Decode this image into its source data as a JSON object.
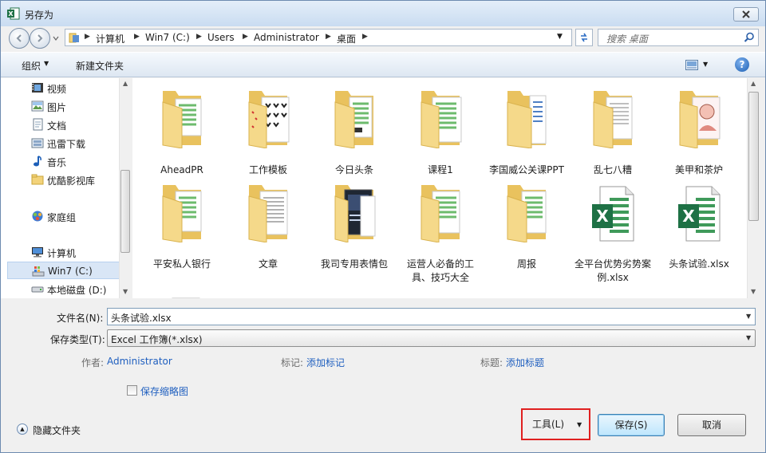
{
  "window": {
    "title": "另存为"
  },
  "address": {
    "crumbs": [
      "计算机",
      "Win7 (C:)",
      "Users",
      "Administrator",
      "桌面"
    ]
  },
  "search": {
    "placeholder": "搜索 桌面"
  },
  "toolbar": {
    "organize": "组织",
    "new_folder": "新建文件夹",
    "help": "?"
  },
  "nav": {
    "items": [
      {
        "label": "视频",
        "icon": "video-library-icon"
      },
      {
        "label": "图片",
        "icon": "pictures-library-icon"
      },
      {
        "label": "文档",
        "icon": "documents-library-icon"
      },
      {
        "label": "迅雷下载",
        "icon": "download-library-icon"
      },
      {
        "label": "音乐",
        "icon": "music-library-icon"
      },
      {
        "label": "优酷影视库",
        "icon": "folder-icon"
      },
      {
        "label": "家庭组",
        "icon": "homegroup-icon"
      },
      {
        "label": "计算机",
        "icon": "computer-icon"
      },
      {
        "label": "Win7 (C:)",
        "icon": "system-drive-icon"
      },
      {
        "label": "本地磁盘 (D:)",
        "icon": "drive-icon"
      }
    ]
  },
  "files": [
    {
      "name": "AheadPR",
      "type": "folder",
      "icon": "folder-docs-icon"
    },
    {
      "name": "工作模板",
      "type": "folder",
      "icon": "folder-cards-icon"
    },
    {
      "name": "今日头条",
      "type": "folder",
      "icon": "folder-docs-icon"
    },
    {
      "name": "课程1",
      "type": "folder",
      "icon": "folder-docs-icon"
    },
    {
      "name": "李国威公关课PPT",
      "type": "folder",
      "icon": "folder-docs-icon"
    },
    {
      "name": "乱七八糟",
      "type": "folder",
      "icon": "folder-docs-icon"
    },
    {
      "name": "美甲和茶炉",
      "type": "folder",
      "icon": "folder-image-icon"
    },
    {
      "name": "平安私人银行",
      "type": "folder",
      "icon": "folder-docs-icon"
    },
    {
      "name": "文章",
      "type": "folder",
      "icon": "folder-docs-icon"
    },
    {
      "name": "我司专用表情包",
      "type": "folder",
      "icon": "folder-image-icon"
    },
    {
      "name": "运营人必备的工具、技巧大全",
      "type": "folder",
      "icon": "folder-docs-icon"
    },
    {
      "name": "周报",
      "type": "folder",
      "icon": "folder-docs-icon"
    },
    {
      "name": "全平台优势劣势案例.xlsx",
      "type": "excel",
      "icon": "excel-file-icon"
    },
    {
      "name": "头条试验.xlsx",
      "type": "excel",
      "icon": "excel-file-icon"
    }
  ],
  "form": {
    "filename_label": "文件名(N):",
    "filename_value": "头条试验.xlsx",
    "filetype_label": "保存类型(T):",
    "filetype_value": "Excel 工作簿(*.xlsx)",
    "author_label": "作者:",
    "author_value": "Administrator",
    "tags_label": "标记:",
    "tags_value": "添加标记",
    "title_label": "标题:",
    "title_value": "添加标题",
    "thumbnail_label": "保存缩略图"
  },
  "footer": {
    "hide_folders": "隐藏文件夹",
    "tools": "工具(L)",
    "save": "保存(S)",
    "cancel": "取消"
  },
  "colors": {
    "link": "#1f5fbf",
    "highlight_box": "#e02020",
    "excel_green": "#1e7145",
    "folder": "#f3d37a"
  }
}
